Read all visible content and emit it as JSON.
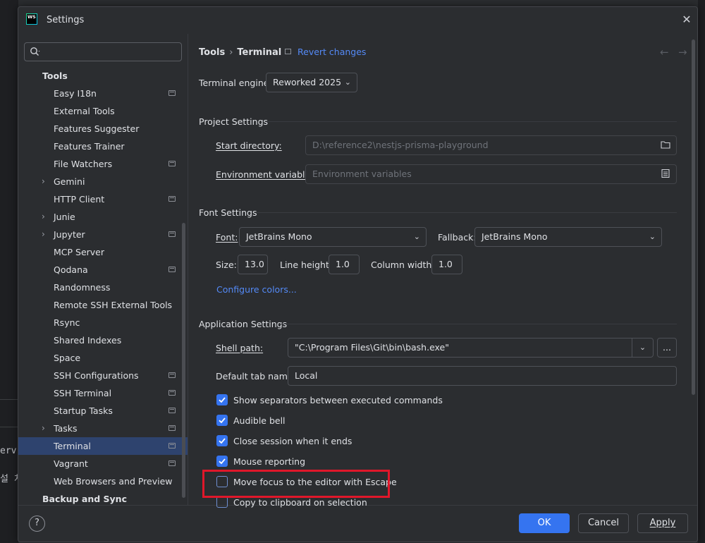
{
  "background": {
    "left_fragment_1": "erv",
    "left_fragment_2": "설 치"
  },
  "dialog": {
    "title": "Settings",
    "app_icon_text": "WS"
  },
  "sidebar": {
    "search": {
      "placeholder": "",
      "value": ""
    },
    "items": [
      {
        "label": "Tools",
        "type": "group"
      },
      {
        "label": "Easy I18n",
        "project": true
      },
      {
        "label": "External Tools"
      },
      {
        "label": "Features Suggester"
      },
      {
        "label": "Features Trainer"
      },
      {
        "label": "File Watchers",
        "project": true
      },
      {
        "label": "Gemini",
        "expandable": true
      },
      {
        "label": "HTTP Client",
        "project": true
      },
      {
        "label": "Junie",
        "expandable": true
      },
      {
        "label": "Jupyter",
        "expandable": true,
        "project": true
      },
      {
        "label": "MCP Server"
      },
      {
        "label": "Qodana",
        "project": true
      },
      {
        "label": "Randomness"
      },
      {
        "label": "Remote SSH External Tools"
      },
      {
        "label": "Rsync"
      },
      {
        "label": "Shared Indexes"
      },
      {
        "label": "Space"
      },
      {
        "label": "SSH Configurations",
        "project": true
      },
      {
        "label": "SSH Terminal",
        "project": true
      },
      {
        "label": "Startup Tasks",
        "project": true
      },
      {
        "label": "Tasks",
        "expandable": true,
        "project": true
      },
      {
        "label": "Terminal",
        "project": true,
        "selected": true
      },
      {
        "label": "Vagrant",
        "project": true
      },
      {
        "label": "Web Browsers and Preview"
      },
      {
        "label": "Backup and Sync",
        "type": "group"
      }
    ]
  },
  "main": {
    "breadcrumb": [
      "Tools",
      "Terminal"
    ],
    "revert_label": "Revert changes",
    "engine": {
      "label": "Terminal engine:",
      "value": "Reworked 2025"
    },
    "project_settings": {
      "title": "Project Settings",
      "start_dir_label": "Start directory:",
      "start_dir_value": "D:\\reference2\\nestjs-prisma-playground",
      "env_label": "Environment variables:",
      "env_placeholder": "Environment variables"
    },
    "font_settings": {
      "title": "Font Settings",
      "font_label": "Font:",
      "font_value": "JetBrains Mono",
      "fallback_label": "Fallback:",
      "fallback_value": "JetBrains Mono",
      "size_label": "Size:",
      "size_value": "13.0",
      "line_height_label": "Line height:",
      "line_height_value": "1.0",
      "column_width_label": "Column width:",
      "column_width_value": "1.0",
      "configure_colors": "Configure colors..."
    },
    "application_settings": {
      "title": "Application Settings",
      "shell_label": "Shell path:",
      "shell_value": "\"C:\\Program Files\\Git\\bin\\bash.exe\"",
      "browse_label": "...",
      "tab_name_label": "Default tab name:",
      "tab_name_value": "Local",
      "checkboxes": [
        {
          "label": "Show separators between executed commands",
          "checked": true
        },
        {
          "label": "Audible bell",
          "checked": true
        },
        {
          "label": "Close session when it ends",
          "checked": true
        },
        {
          "label": "Mouse reporting",
          "checked": true
        },
        {
          "label": "Move focus to the editor with Escape",
          "checked": false
        },
        {
          "label": "Copy to clipboard on selection",
          "checked": false
        }
      ]
    }
  },
  "footer": {
    "help": "?",
    "ok": "OK",
    "cancel": "Cancel",
    "apply": "Apply"
  },
  "colors": {
    "accent": "#3574f0",
    "selection": "#2e436e",
    "link": "#548af7",
    "highlight_box": "#e0172a"
  }
}
